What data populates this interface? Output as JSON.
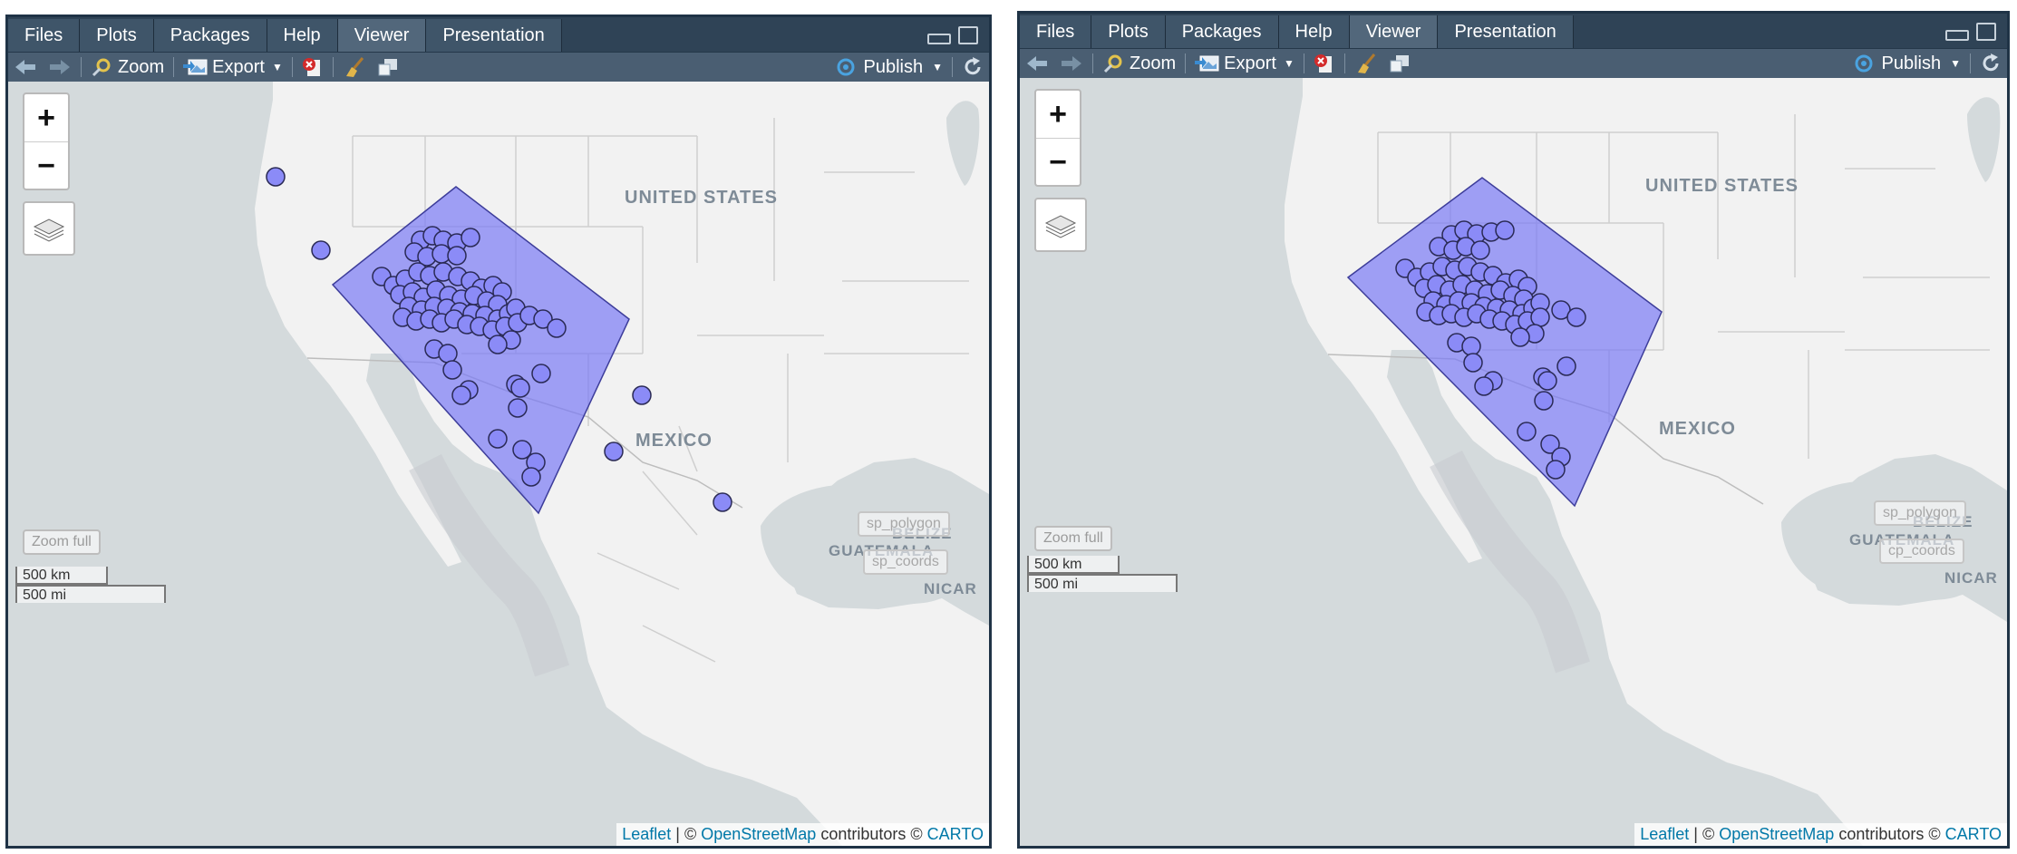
{
  "panes": [
    {
      "tabs": [
        "Files",
        "Plots",
        "Packages",
        "Help",
        "Viewer",
        "Presentation"
      ],
      "active_tab": "Viewer",
      "toolbar": {
        "zoom": "Zoom",
        "export": "Export",
        "publish": "Publish"
      },
      "map": {
        "zoom_in": "+",
        "zoom_out": "−",
        "zoom_full": "Zoom full",
        "btn_polygon": "sp_polygon",
        "btn_coords": "sp_coords",
        "scale_km": "500 km",
        "scale_mi": "500 mi",
        "labels": {
          "us": "UNITED STATES",
          "mexico": "MEXICO",
          "belize": "BELIZE",
          "guatemala": "GUATEMALA",
          "nicaragua": "NICAR"
        },
        "attribution": {
          "leaflet": "Leaflet",
          "sep": " | © ",
          "osm": "OpenStreetMap",
          "contrib": " contributors © ",
          "carto": "CARTO"
        }
      }
    },
    {
      "tabs": [
        "Files",
        "Plots",
        "Packages",
        "Help",
        "Viewer",
        "Presentation"
      ],
      "active_tab": "Viewer",
      "toolbar": {
        "zoom": "Zoom",
        "export": "Export",
        "publish": "Publish"
      },
      "map": {
        "zoom_in": "+",
        "zoom_out": "−",
        "zoom_full": "Zoom full",
        "btn_polygon": "sp_polygon",
        "btn_coords": "cp_coords",
        "scale_km": "500 km",
        "scale_mi": "500 mi",
        "labels": {
          "us": "UNITED STATES",
          "mexico": "MEXICO",
          "belize": "BELIZE",
          "guatemala": "GUATEMALA",
          "nicaragua": "NICAR"
        },
        "attribution": {
          "leaflet": "Leaflet",
          "sep": " | © ",
          "osm": "OpenStreetMap",
          "contrib": " contributors © ",
          "carto": "CARTO"
        }
      }
    }
  ],
  "colors": {
    "polygon_fill": "#7b7bf5",
    "point_fill": "#8b8bf7",
    "land": "#f2f2f2",
    "water": "#d4dadc",
    "border": "#c9c9c9"
  }
}
